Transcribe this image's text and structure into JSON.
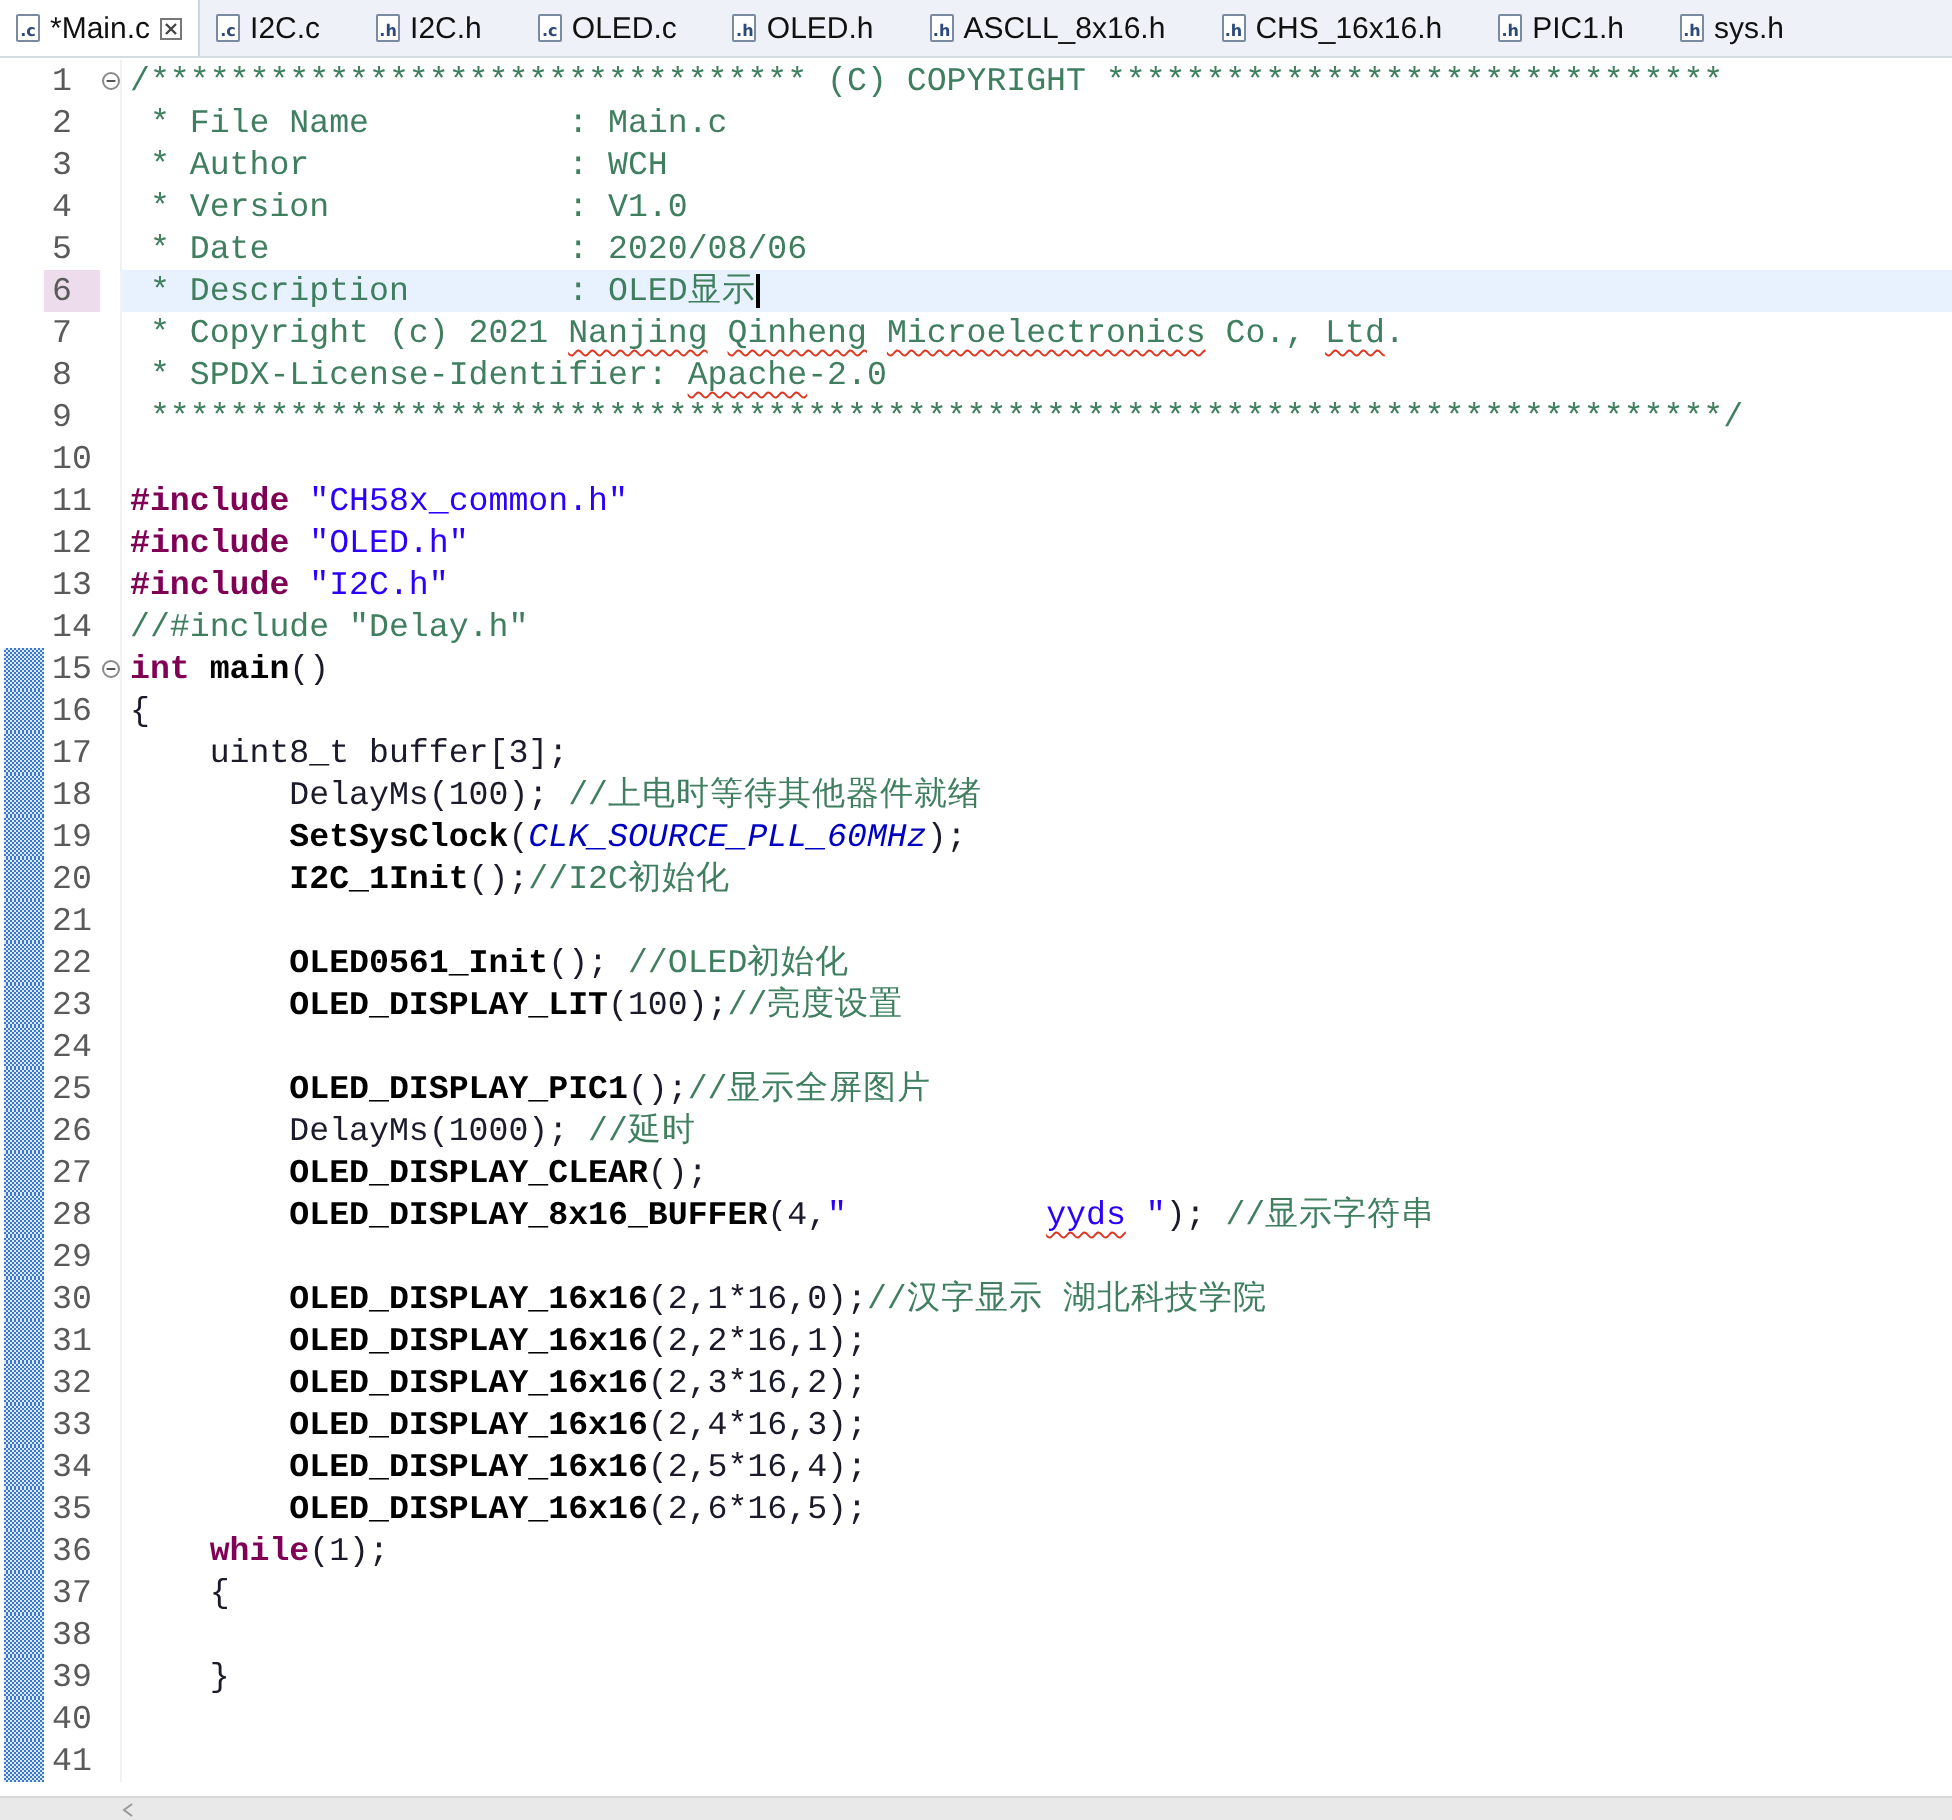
{
  "tabs": [
    {
      "icon_text": ".c",
      "label": "*Main.c",
      "selected": true
    },
    {
      "icon_text": ".c",
      "label": "I2C.c",
      "selected": false
    },
    {
      "icon_text": ".h",
      "label": "I2C.h",
      "selected": false
    },
    {
      "icon_text": ".c",
      "label": "OLED.c",
      "selected": false
    },
    {
      "icon_text": ".h",
      "label": "OLED.h",
      "selected": false
    },
    {
      "icon_text": ".h",
      "label": "ASCLL_8x16.h",
      "selected": false
    },
    {
      "icon_text": ".h",
      "label": "CHS_16x16.h",
      "selected": false
    },
    {
      "icon_text": ".h",
      "label": "PIC1.h",
      "selected": false
    },
    {
      "icon_text": ".h",
      "label": "sys.h",
      "selected": false
    }
  ],
  "lines": [
    {
      "number": "1",
      "selected": false,
      "changed": false,
      "foldable": true,
      "segments": [
        {
          "kind": "comment",
          "text": "/********************************* (C) COPYRIGHT *******************************"
        }
      ]
    },
    {
      "number": "2",
      "selected": false,
      "changed": false,
      "foldable": false,
      "segments": [
        {
          "kind": "comment",
          "text": " * File Name          : Main.c"
        }
      ]
    },
    {
      "number": "3",
      "selected": false,
      "changed": false,
      "foldable": false,
      "segments": [
        {
          "kind": "comment",
          "text": " * Author             : WCH"
        }
      ]
    },
    {
      "number": "4",
      "selected": false,
      "changed": false,
      "foldable": false,
      "segments": [
        {
          "kind": "comment",
          "text": " * Version            : V1.0"
        }
      ]
    },
    {
      "number": "5",
      "selected": false,
      "changed": false,
      "foldable": false,
      "segments": [
        {
          "kind": "comment",
          "text": " * Date               : 2020/08/06"
        }
      ]
    },
    {
      "number": "6",
      "selected": true,
      "changed": false,
      "foldable": false,
      "segments": [
        {
          "kind": "comment",
          "text": " * Description        : OLED显示"
        }
      ]
    },
    {
      "number": "7",
      "selected": false,
      "changed": false,
      "foldable": false,
      "segments": [
        {
          "kind": "comment",
          "text": " * Copyright (c) 2021 "
        },
        {
          "kind": "comment",
          "text": "Nanjing",
          "flagged": true
        },
        {
          "kind": "comment",
          "text": " Qinheng",
          "flagged": true
        },
        {
          "kind": "comment",
          "text": " Microelectronics",
          "flagged": true
        },
        {
          "kind": "comment",
          "text": " Co., "
        },
        {
          "kind": "comment",
          "text": "Ltd",
          "flagged": true
        },
        {
          "kind": "comment",
          "text": "."
        }
      ]
    },
    {
      "number": "8",
      "selected": false,
      "changed": false,
      "foldable": false,
      "segments": [
        {
          "kind": "comment",
          "text": " * SPDX-License-Identifier: "
        },
        {
          "kind": "comment",
          "text": "Apache",
          "flagged": true
        },
        {
          "kind": "comment",
          "text": "-2.0"
        }
      ]
    },
    {
      "number": "9",
      "selected": false,
      "changed": false,
      "foldable": false,
      "segments": [
        {
          "kind": "comment",
          "text": " *******************************************************************************/"
        }
      ]
    },
    {
      "number": "10",
      "selected": false,
      "changed": false,
      "foldable": false
    },
    {
      "number": "11",
      "selected": false,
      "changed": false,
      "foldable": false,
      "segments": [
        {
          "kind": "keyword",
          "text": "#include"
        },
        {
          "kind": "string",
          "text": " \"CH58x_common.h\""
        }
      ]
    },
    {
      "number": "12",
      "selected": false,
      "changed": false,
      "foldable": false,
      "segments": [
        {
          "kind": "keyword",
          "text": "#include"
        },
        {
          "kind": "string",
          "text": " \"OLED.h\""
        }
      ]
    },
    {
      "number": "13",
      "selected": false,
      "changed": false,
      "foldable": false,
      "segments": [
        {
          "kind": "keyword",
          "text": "#include"
        },
        {
          "kind": "string",
          "text": " \"I2C.h\""
        }
      ]
    },
    {
      "number": "14",
      "selected": false,
      "changed": false,
      "foldable": false,
      "segments": [
        {
          "kind": "comment",
          "text": "//#include \"Delay.h\""
        }
      ]
    },
    {
      "number": "15",
      "selected": false,
      "changed": true,
      "foldable": true,
      "segments": [
        {
          "kind": "keyword",
          "text": "int"
        },
        {
          "kind": "function",
          "text": " main"
        },
        {
          "kind": "plain",
          "text": "()"
        }
      ]
    },
    {
      "number": "16",
      "selected": false,
      "changed": true,
      "foldable": false,
      "segments": [
        {
          "kind": "plain",
          "text": "{"
        }
      ]
    },
    {
      "number": "17",
      "selected": false,
      "changed": true,
      "foldable": false,
      "segments": [
        {
          "kind": "plain",
          "text": "    uint8_t buffer[3];"
        }
      ]
    },
    {
      "number": "18",
      "selected": false,
      "changed": true,
      "foldable": false,
      "segments": [
        {
          "kind": "plain",
          "text": "        DelayMs(100); "
        },
        {
          "kind": "comment",
          "text": "//上电时等待其他器件就绪"
        }
      ]
    },
    {
      "number": "19",
      "selected": false,
      "changed": true,
      "foldable": false,
      "segments": [
        {
          "kind": "function",
          "text": "        SetSysClock"
        },
        {
          "kind": "plain",
          "text": "("
        },
        {
          "kind": "macro",
          "text": "CLK_SOURCE_PLL_60MHz"
        },
        {
          "kind": "plain",
          "text": ");"
        }
      ]
    },
    {
      "number": "20",
      "selected": false,
      "changed": true,
      "foldable": false,
      "segments": [
        {
          "kind": "function",
          "text": "        I2C_1Init"
        },
        {
          "kind": "plain",
          "text": "();"
        },
        {
          "kind": "comment",
          "text": "//I2C初始化"
        }
      ]
    },
    {
      "number": "21",
      "selected": false,
      "changed": true,
      "foldable": false
    },
    {
      "number": "22",
      "selected": false,
      "changed": true,
      "foldable": false,
      "segments": [
        {
          "kind": "function",
          "text": "        OLED0561_Init"
        },
        {
          "kind": "plain",
          "text": "(); "
        },
        {
          "kind": "comment",
          "text": "//OLED初始化"
        }
      ]
    },
    {
      "number": "23",
      "selected": false,
      "changed": true,
      "foldable": false,
      "segments": [
        {
          "kind": "function",
          "text": "        OLED_DISPLAY_LIT"
        },
        {
          "kind": "plain",
          "text": "(100);"
        },
        {
          "kind": "comment",
          "text": "//亮度设置"
        }
      ]
    },
    {
      "number": "24",
      "selected": false,
      "changed": true,
      "foldable": false
    },
    {
      "number": "25",
      "selected": false,
      "changed": true,
      "foldable": false,
      "segments": [
        {
          "kind": "function",
          "text": "        OLED_DISPLAY_PIC1"
        },
        {
          "kind": "plain",
          "text": "();"
        },
        {
          "kind": "comment",
          "text": "//显示全屏图片"
        }
      ]
    },
    {
      "number": "26",
      "selected": false,
      "changed": true,
      "foldable": false,
      "segments": [
        {
          "kind": "plain",
          "text": "        DelayMs(1000); "
        },
        {
          "kind": "comment",
          "text": "//延时"
        }
      ]
    },
    {
      "number": "27",
      "selected": false,
      "changed": true,
      "foldable": false,
      "segments": [
        {
          "kind": "function",
          "text": "        OLED_DISPLAY_CLEAR"
        },
        {
          "kind": "plain",
          "text": "();"
        }
      ]
    },
    {
      "number": "28",
      "selected": false,
      "changed": true,
      "foldable": false,
      "segments": [
        {
          "kind": "function",
          "text": "        OLED_DISPLAY_8x16_BUFFER"
        },
        {
          "kind": "plain",
          "text": "(4,"
        },
        {
          "kind": "string",
          "text": "\"          "
        },
        {
          "kind": "string",
          "text": "yyds",
          "flagged": true
        },
        {
          "kind": "string",
          "text": " \""
        },
        {
          "kind": "plain",
          "text": "); "
        },
        {
          "kind": "comment",
          "text": "//显示字符串"
        }
      ]
    },
    {
      "number": "29",
      "selected": false,
      "changed": true,
      "foldable": false
    },
    {
      "number": "30",
      "selected": false,
      "changed": true,
      "foldable": false,
      "segments": [
        {
          "kind": "function",
          "text": "        OLED_DISPLAY_16x16"
        },
        {
          "kind": "plain",
          "text": "(2,1*16,0);"
        },
        {
          "kind": "comment",
          "text": "//汉字显示 湖北科技学院"
        }
      ]
    },
    {
      "number": "31",
      "selected": false,
      "changed": true,
      "foldable": false,
      "segments": [
        {
          "kind": "function",
          "text": "        OLED_DISPLAY_16x16"
        },
        {
          "kind": "plain",
          "text": "(2,2*16,1);"
        }
      ]
    },
    {
      "number": "32",
      "selected": false,
      "changed": true,
      "foldable": false,
      "segments": [
        {
          "kind": "function",
          "text": "        OLED_DISPLAY_16x16"
        },
        {
          "kind": "plain",
          "text": "(2,3*16,2);"
        }
      ]
    },
    {
      "number": "33",
      "selected": false,
      "changed": true,
      "foldable": false,
      "segments": [
        {
          "kind": "function",
          "text": "        OLED_DISPLAY_16x16"
        },
        {
          "kind": "plain",
          "text": "(2,4*16,3);"
        }
      ]
    },
    {
      "number": "34",
      "selected": false,
      "changed": true,
      "foldable": false,
      "segments": [
        {
          "kind": "function",
          "text": "        OLED_DISPLAY_16x16"
        },
        {
          "kind": "plain",
          "text": "(2,5*16,4);"
        }
      ]
    },
    {
      "number": "35",
      "selected": false,
      "changed": true,
      "foldable": false,
      "segments": [
        {
          "kind": "function",
          "text": "        OLED_DISPLAY_16x16"
        },
        {
          "kind": "plain",
          "text": "(2,6*16,5);"
        }
      ]
    },
    {
      "number": "36",
      "selected": false,
      "changed": true,
      "foldable": false,
      "segments": [
        {
          "kind": "keyword",
          "text": "    while"
        },
        {
          "kind": "plain",
          "text": "(1);"
        }
      ]
    },
    {
      "number": "37",
      "selected": false,
      "changed": true,
      "foldable": false,
      "segments": [
        {
          "kind": "plain",
          "text": "    {"
        }
      ]
    },
    {
      "number": "38",
      "selected": false,
      "changed": true,
      "foldable": false
    },
    {
      "number": "39",
      "selected": false,
      "changed": true,
      "foldable": false,
      "segments": [
        {
          "kind": "plain",
          "text": "    }"
        }
      ]
    },
    {
      "number": "40",
      "selected": false,
      "changed": true,
      "foldable": false
    },
    {
      "number": "41",
      "selected": false,
      "changed": true,
      "foldable": false
    }
  ]
}
